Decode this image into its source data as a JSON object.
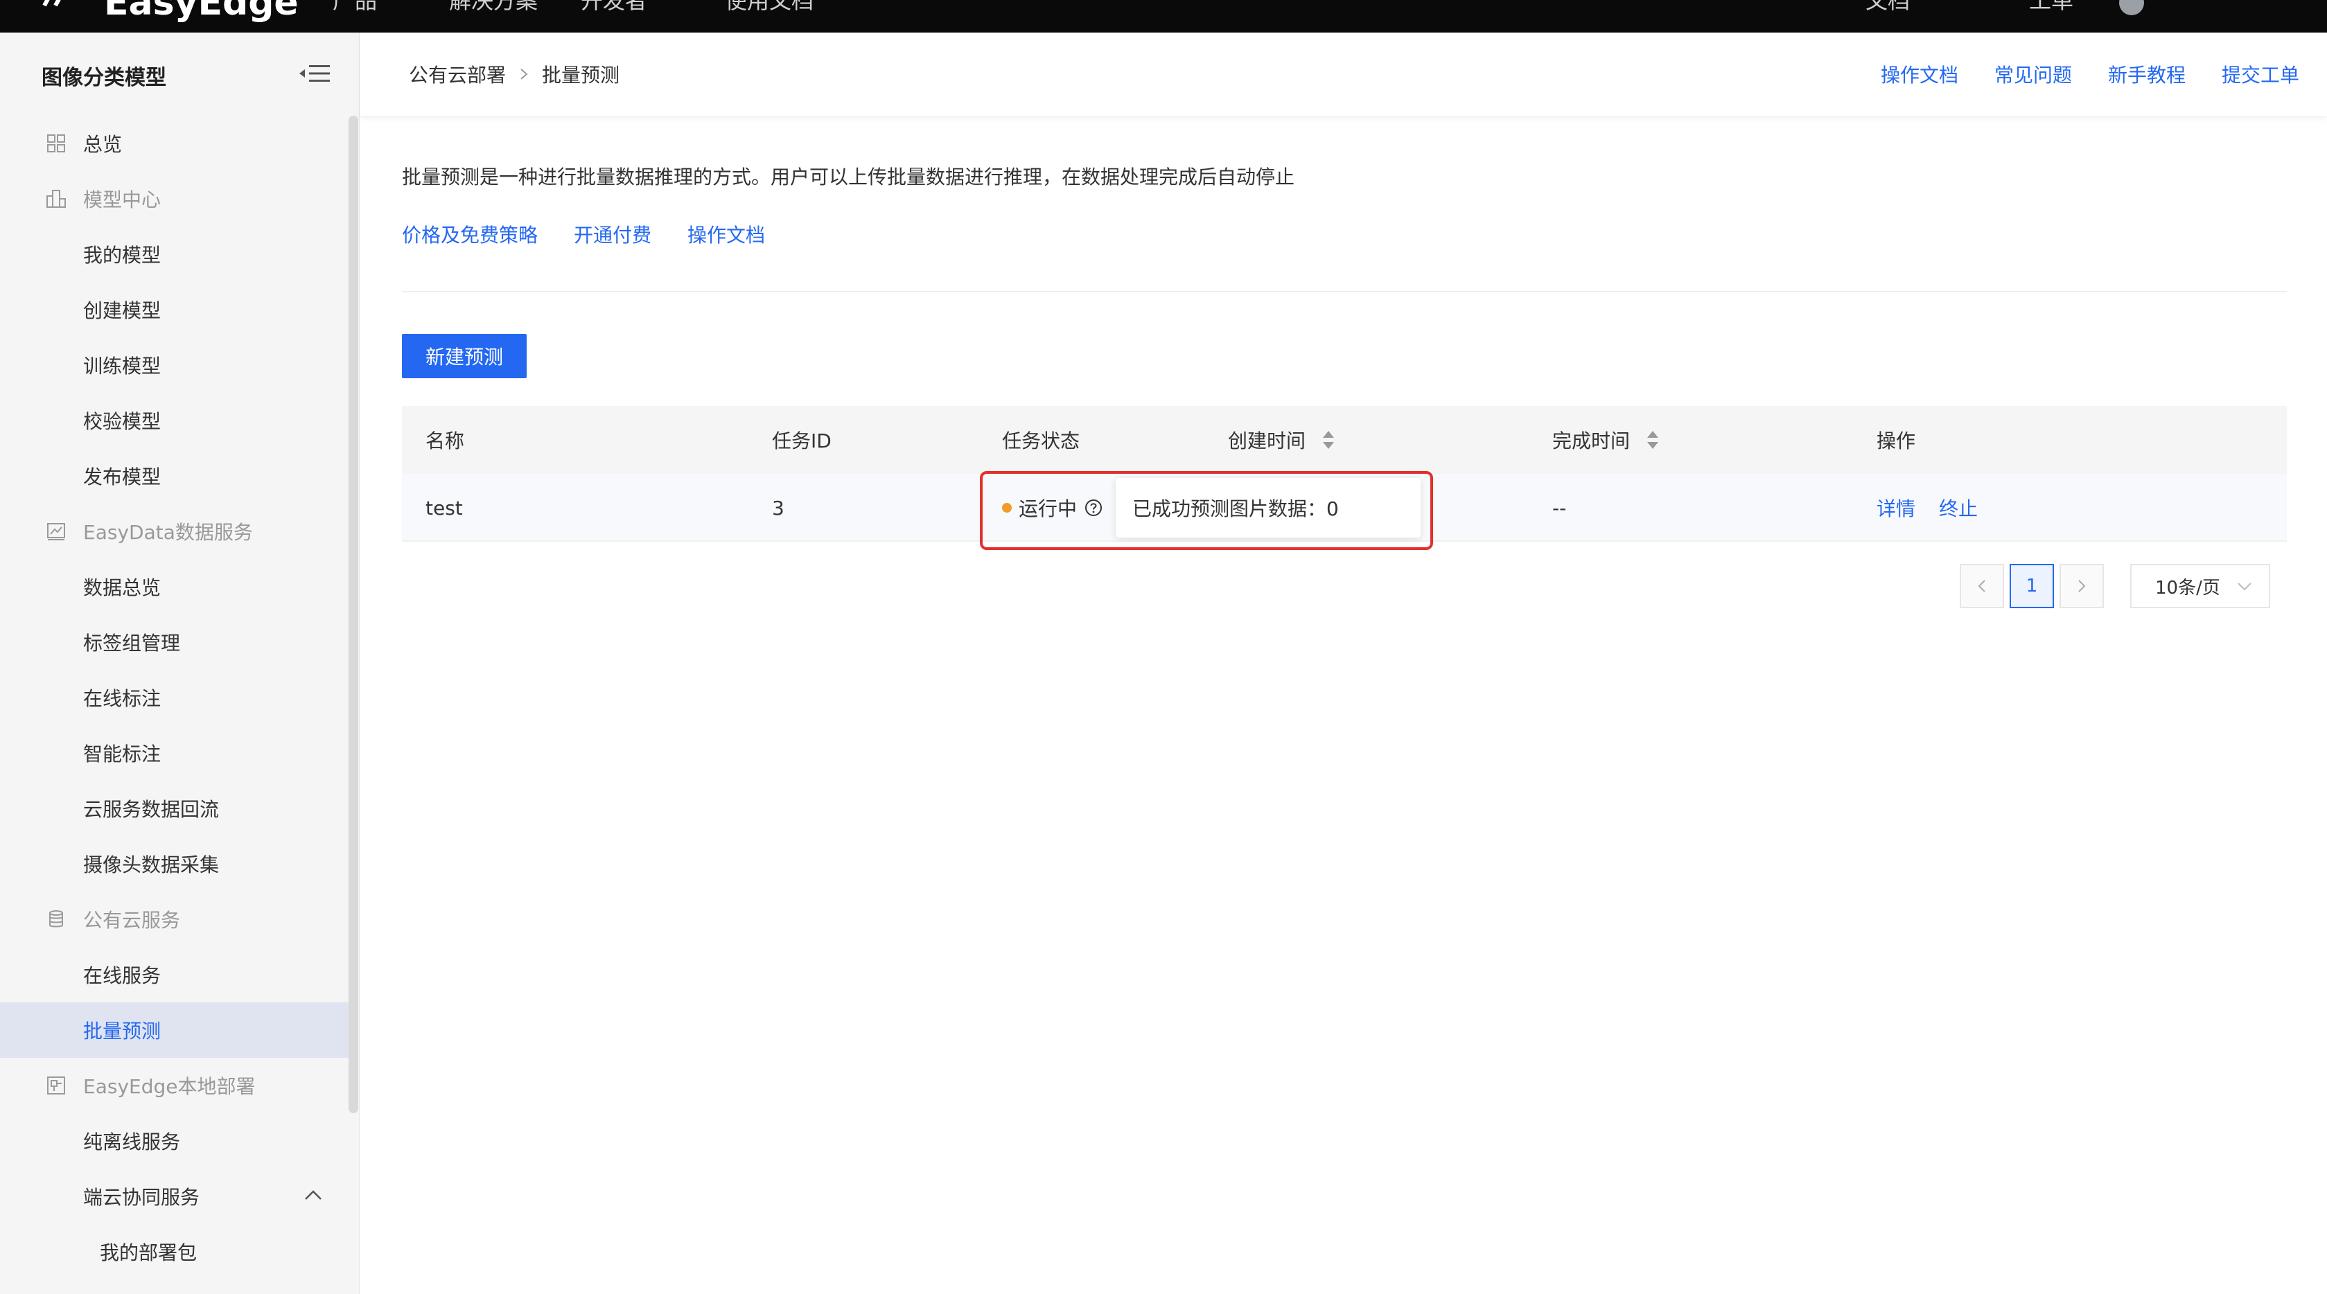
{
  "topbar": {
    "logo_text": "EasyEdge",
    "nav": [
      "产品",
      "解决方案",
      "开发者",
      "使用文档"
    ],
    "right_items": [
      "文档",
      "工单"
    ]
  },
  "sidebar": {
    "title": "图像分类模型",
    "groups": {
      "overview": "总览",
      "model_center": "模型中心",
      "easydata": "EasyData数据服务",
      "public_cloud": "公有云服务",
      "easyedge": "EasyEdge本地部署"
    },
    "items": {
      "my_models": "我的模型",
      "create_model": "创建模型",
      "train_model": "训练模型",
      "validate_model": "校验模型",
      "publish_model": "发布模型",
      "data_overview": "数据总览",
      "label_group": "标签组管理",
      "online_label": "在线标注",
      "smart_label": "智能标注",
      "cloud_reflow": "云服务数据回流",
      "camera_collect": "摄像头数据采集",
      "online_service": "在线服务",
      "batch_predict": "批量预测",
      "offline_service": "纯离线服务",
      "edge_cloud": "端云协同服务",
      "my_packages": "我的部署包"
    }
  },
  "header": {
    "breadcrumb": [
      "公有云部署",
      "批量预测"
    ],
    "links": [
      "操作文档",
      "常见问题",
      "新手教程",
      "提交工单"
    ]
  },
  "content": {
    "description": "批量预测是一种进行批量数据推理的方式。用户可以上传批量数据进行推理，在数据处理完成后自动停止",
    "links": [
      "价格及免费策略",
      "开通付费",
      "操作文档"
    ],
    "new_button": "新建预测"
  },
  "table": {
    "columns": [
      "名称",
      "任务ID",
      "任务状态",
      "创建时间",
      "完成时间",
      "操作"
    ],
    "rows": [
      {
        "name": "test",
        "task_id": "3",
        "status": "运行中",
        "status_color": "#f29b25",
        "tooltip": "已成功预测图片数据：0",
        "finish_time": "--",
        "actions": [
          "详情",
          "终止"
        ]
      }
    ]
  },
  "pagination": {
    "current_page": "1",
    "page_size": "10条/页"
  },
  "colors": {
    "accent": "#2468f2",
    "highlight_box": "#e3302b",
    "status_running": "#f29b25"
  }
}
